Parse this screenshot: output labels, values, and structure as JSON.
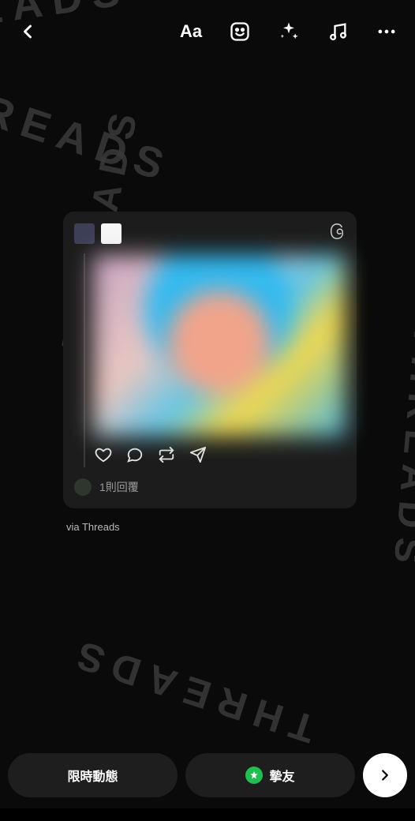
{
  "topbar": {
    "back": "back",
    "tools": {
      "text": "Aa",
      "sticker": "sticker",
      "sparkle": "effects",
      "music": "music",
      "more": "more"
    }
  },
  "card": {
    "reply_count": "1則回覆"
  },
  "via": "via Threads",
  "bottom": {
    "story_label": "限時動態",
    "close_friends_label": "摯友"
  },
  "decor": {
    "word": "THREADS"
  }
}
